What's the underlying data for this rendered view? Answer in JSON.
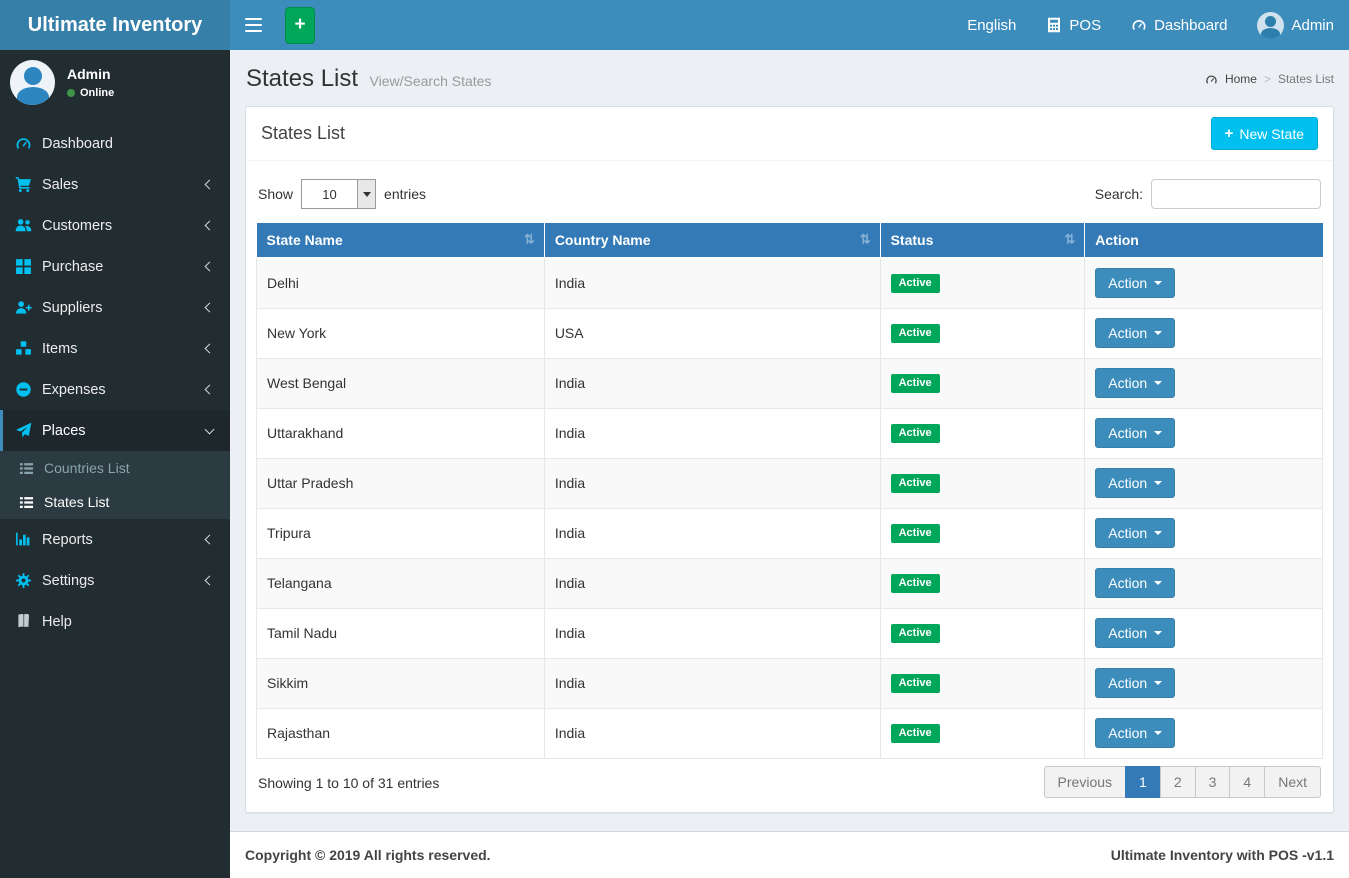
{
  "colors": {
    "navbar_blue": "#3c8dbc",
    "logo_blue": "#367fa9",
    "sidebar_dark": "#222d32",
    "submenu_dark": "#2c3b41",
    "icon_cyan": "#00c0ef",
    "green": "#00a65a",
    "table_header_blue": "#337ab7",
    "content_bg": "#ecf0f5"
  },
  "navbar": {
    "brand": "Ultimate Inventory",
    "items": [
      {
        "label": "English",
        "icon": null
      },
      {
        "label": "POS",
        "icon": "calculator"
      },
      {
        "label": "Dashboard",
        "icon": "tachometer"
      },
      {
        "label": "Admin",
        "icon": "avatar"
      }
    ]
  },
  "sidebar": {
    "user": {
      "name": "Admin",
      "status": "Online"
    },
    "menu": [
      {
        "label": "Dashboard",
        "icon": "tachometer",
        "chevron": null,
        "active": false
      },
      {
        "label": "Sales",
        "icon": "cart",
        "chevron": "left",
        "active": false
      },
      {
        "label": "Customers",
        "icon": "users",
        "chevron": "left",
        "active": false
      },
      {
        "label": "Purchase",
        "icon": "grid",
        "chevron": "left",
        "active": false
      },
      {
        "label": "Suppliers",
        "icon": "user-plus",
        "chevron": "left",
        "active": false
      },
      {
        "label": "Items",
        "icon": "cubes",
        "chevron": "left",
        "active": false
      },
      {
        "label": "Expenses",
        "icon": "minus-circle",
        "chevron": "left",
        "active": false
      },
      {
        "label": "Places",
        "icon": "paper-plane",
        "chevron": "down",
        "active": true,
        "submenu": [
          {
            "label": "Countries List",
            "icon": "list",
            "active": false
          },
          {
            "label": "States List",
            "icon": "list",
            "active": true
          }
        ]
      },
      {
        "label": "Reports",
        "icon": "chart",
        "chevron": "left",
        "active": false
      },
      {
        "label": "Settings",
        "icon": "gears",
        "chevron": "left",
        "active": false
      },
      {
        "label": "Help",
        "icon": "book",
        "chevron": null,
        "active": false,
        "muted_icon": true
      }
    ]
  },
  "content_header": {
    "title": "States List",
    "subtitle": "View/Search States",
    "breadcrumb": [
      {
        "label": "Home",
        "icon": "tachometer"
      },
      {
        "label": "States List"
      }
    ]
  },
  "panel": {
    "title": "States List",
    "new_button_label": "New State",
    "length_label_before": "Show",
    "length_value": "10",
    "length_label_after": "entries",
    "search_label": "Search:",
    "search_value": ""
  },
  "table": {
    "columns": [
      {
        "label": "State Name",
        "sortable": true
      },
      {
        "label": "Country Name",
        "sortable": true
      },
      {
        "label": "Status",
        "sortable": true
      },
      {
        "label": "Action",
        "sortable": false
      }
    ],
    "rows": [
      {
        "state": "Delhi",
        "country": "India",
        "status": "Active",
        "action_label": "Action"
      },
      {
        "state": "New York",
        "country": "USA",
        "status": "Active",
        "action_label": "Action"
      },
      {
        "state": "West Bengal",
        "country": "India",
        "status": "Active",
        "action_label": "Action"
      },
      {
        "state": "Uttarakhand",
        "country": "India",
        "status": "Active",
        "action_label": "Action"
      },
      {
        "state": "Uttar Pradesh",
        "country": "India",
        "status": "Active",
        "action_label": "Action"
      },
      {
        "state": "Tripura",
        "country": "India",
        "status": "Active",
        "action_label": "Action"
      },
      {
        "state": "Telangana",
        "country": "India",
        "status": "Active",
        "action_label": "Action"
      },
      {
        "state": "Tamil Nadu",
        "country": "India",
        "status": "Active",
        "action_label": "Action"
      },
      {
        "state": "Sikkim",
        "country": "India",
        "status": "Active",
        "action_label": "Action"
      },
      {
        "state": "Rajasthan",
        "country": "India",
        "status": "Active",
        "action_label": "Action"
      }
    ],
    "info": "Showing 1 to 10 of 31 entries",
    "pagination": [
      {
        "label": "Previous",
        "active": false
      },
      {
        "label": "1",
        "active": true
      },
      {
        "label": "2",
        "active": false
      },
      {
        "label": "3",
        "active": false
      },
      {
        "label": "4",
        "active": false
      },
      {
        "label": "Next",
        "active": false
      }
    ]
  },
  "footer": {
    "copyright": "Copyright © 2019 All rights reserved.",
    "version": "Ultimate Inventory with POS -v1.1"
  }
}
